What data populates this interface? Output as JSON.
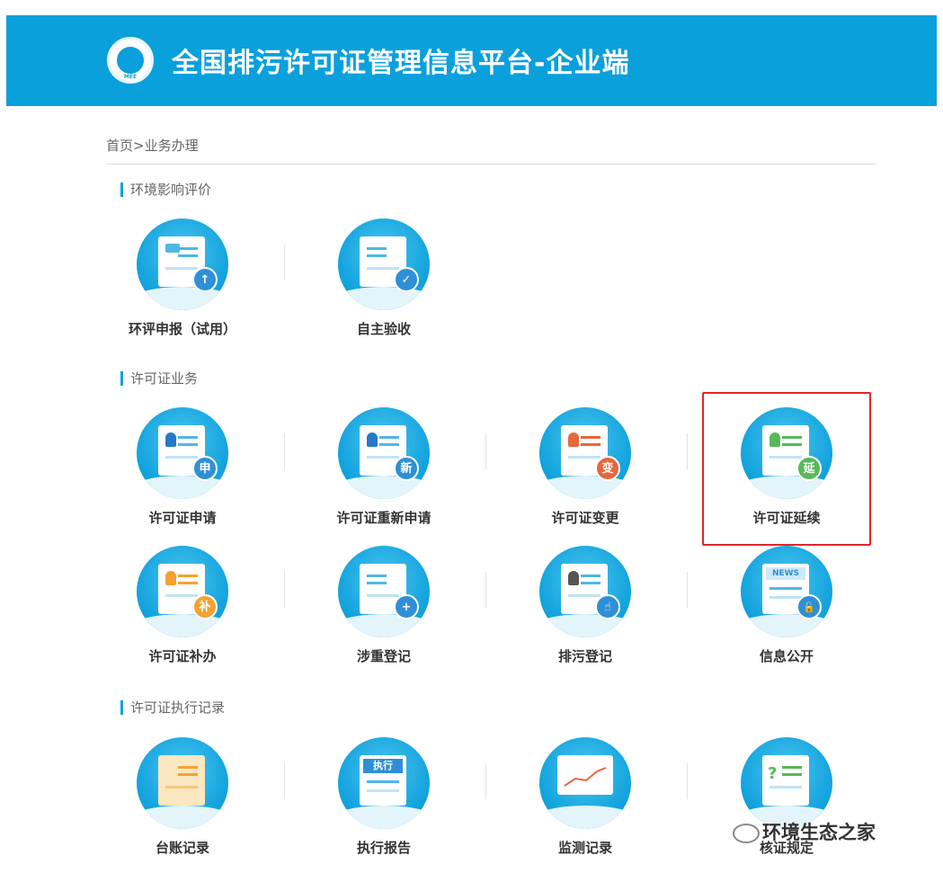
{
  "header": {
    "title": "全国排污许可证管理信息平台-企业端",
    "logo_text": "MEE"
  },
  "breadcrumb": "首页>业务办理",
  "sections": [
    {
      "title": "环境影响评价",
      "tiles": [
        {
          "label": "环评申报（试用）",
          "icon": "upload-document-icon",
          "badge": "↑",
          "badge_color": "#2f8fd6"
        },
        {
          "label": "自主验收",
          "icon": "checklist-check-icon",
          "badge": "✓",
          "badge_color": "#2f8fd6"
        }
      ]
    },
    {
      "title": "许可证业务",
      "tiles": [
        {
          "label": "许可证申请",
          "icon": "license-apply-icon",
          "badge": "申",
          "badge_color": "#2f8fd6"
        },
        {
          "label": "许可证重新申请",
          "icon": "license-reapply-icon",
          "badge": "新",
          "badge_color": "#2f8fd6"
        },
        {
          "label": "许可证变更",
          "icon": "license-change-icon",
          "badge": "变",
          "badge_color": "#e8663c"
        },
        {
          "label": "许可证延续",
          "icon": "license-renew-icon",
          "badge": "延",
          "badge_color": "#56b957"
        },
        {
          "label": "许可证补办",
          "icon": "license-reissue-icon",
          "badge": "补",
          "badge_color": "#f3a232"
        },
        {
          "label": "涉重登记",
          "icon": "heavy-metal-register-icon",
          "badge": "+",
          "badge_color": "#2f8fd6"
        },
        {
          "label": "排污登记",
          "icon": "discharge-register-icon",
          "badge": "☝",
          "badge_color": "#2f8fd6"
        },
        {
          "label": "信息公开",
          "icon": "news-disclosure-icon",
          "badge": "🔓",
          "badge_color": "#2f8fd6",
          "header_text": "NEWS"
        }
      ]
    },
    {
      "title": "许可证执行记录",
      "tiles": [
        {
          "label": "台账记录",
          "icon": "ledger-record-icon",
          "badge": "",
          "badge_color": "#f3a232"
        },
        {
          "label": "执行报告",
          "icon": "execution-report-icon",
          "badge": "",
          "badge_color": "#2f8fd6",
          "header_text": "执行"
        },
        {
          "label": "监测记录",
          "icon": "monitoring-record-icon",
          "badge": "",
          "badge_color": "#e8663c"
        },
        {
          "label": "核证规定",
          "icon": "verification-rule-icon",
          "badge": "?",
          "badge_color": "#56b957"
        }
      ]
    }
  ],
  "watermark": "环境生态之家"
}
